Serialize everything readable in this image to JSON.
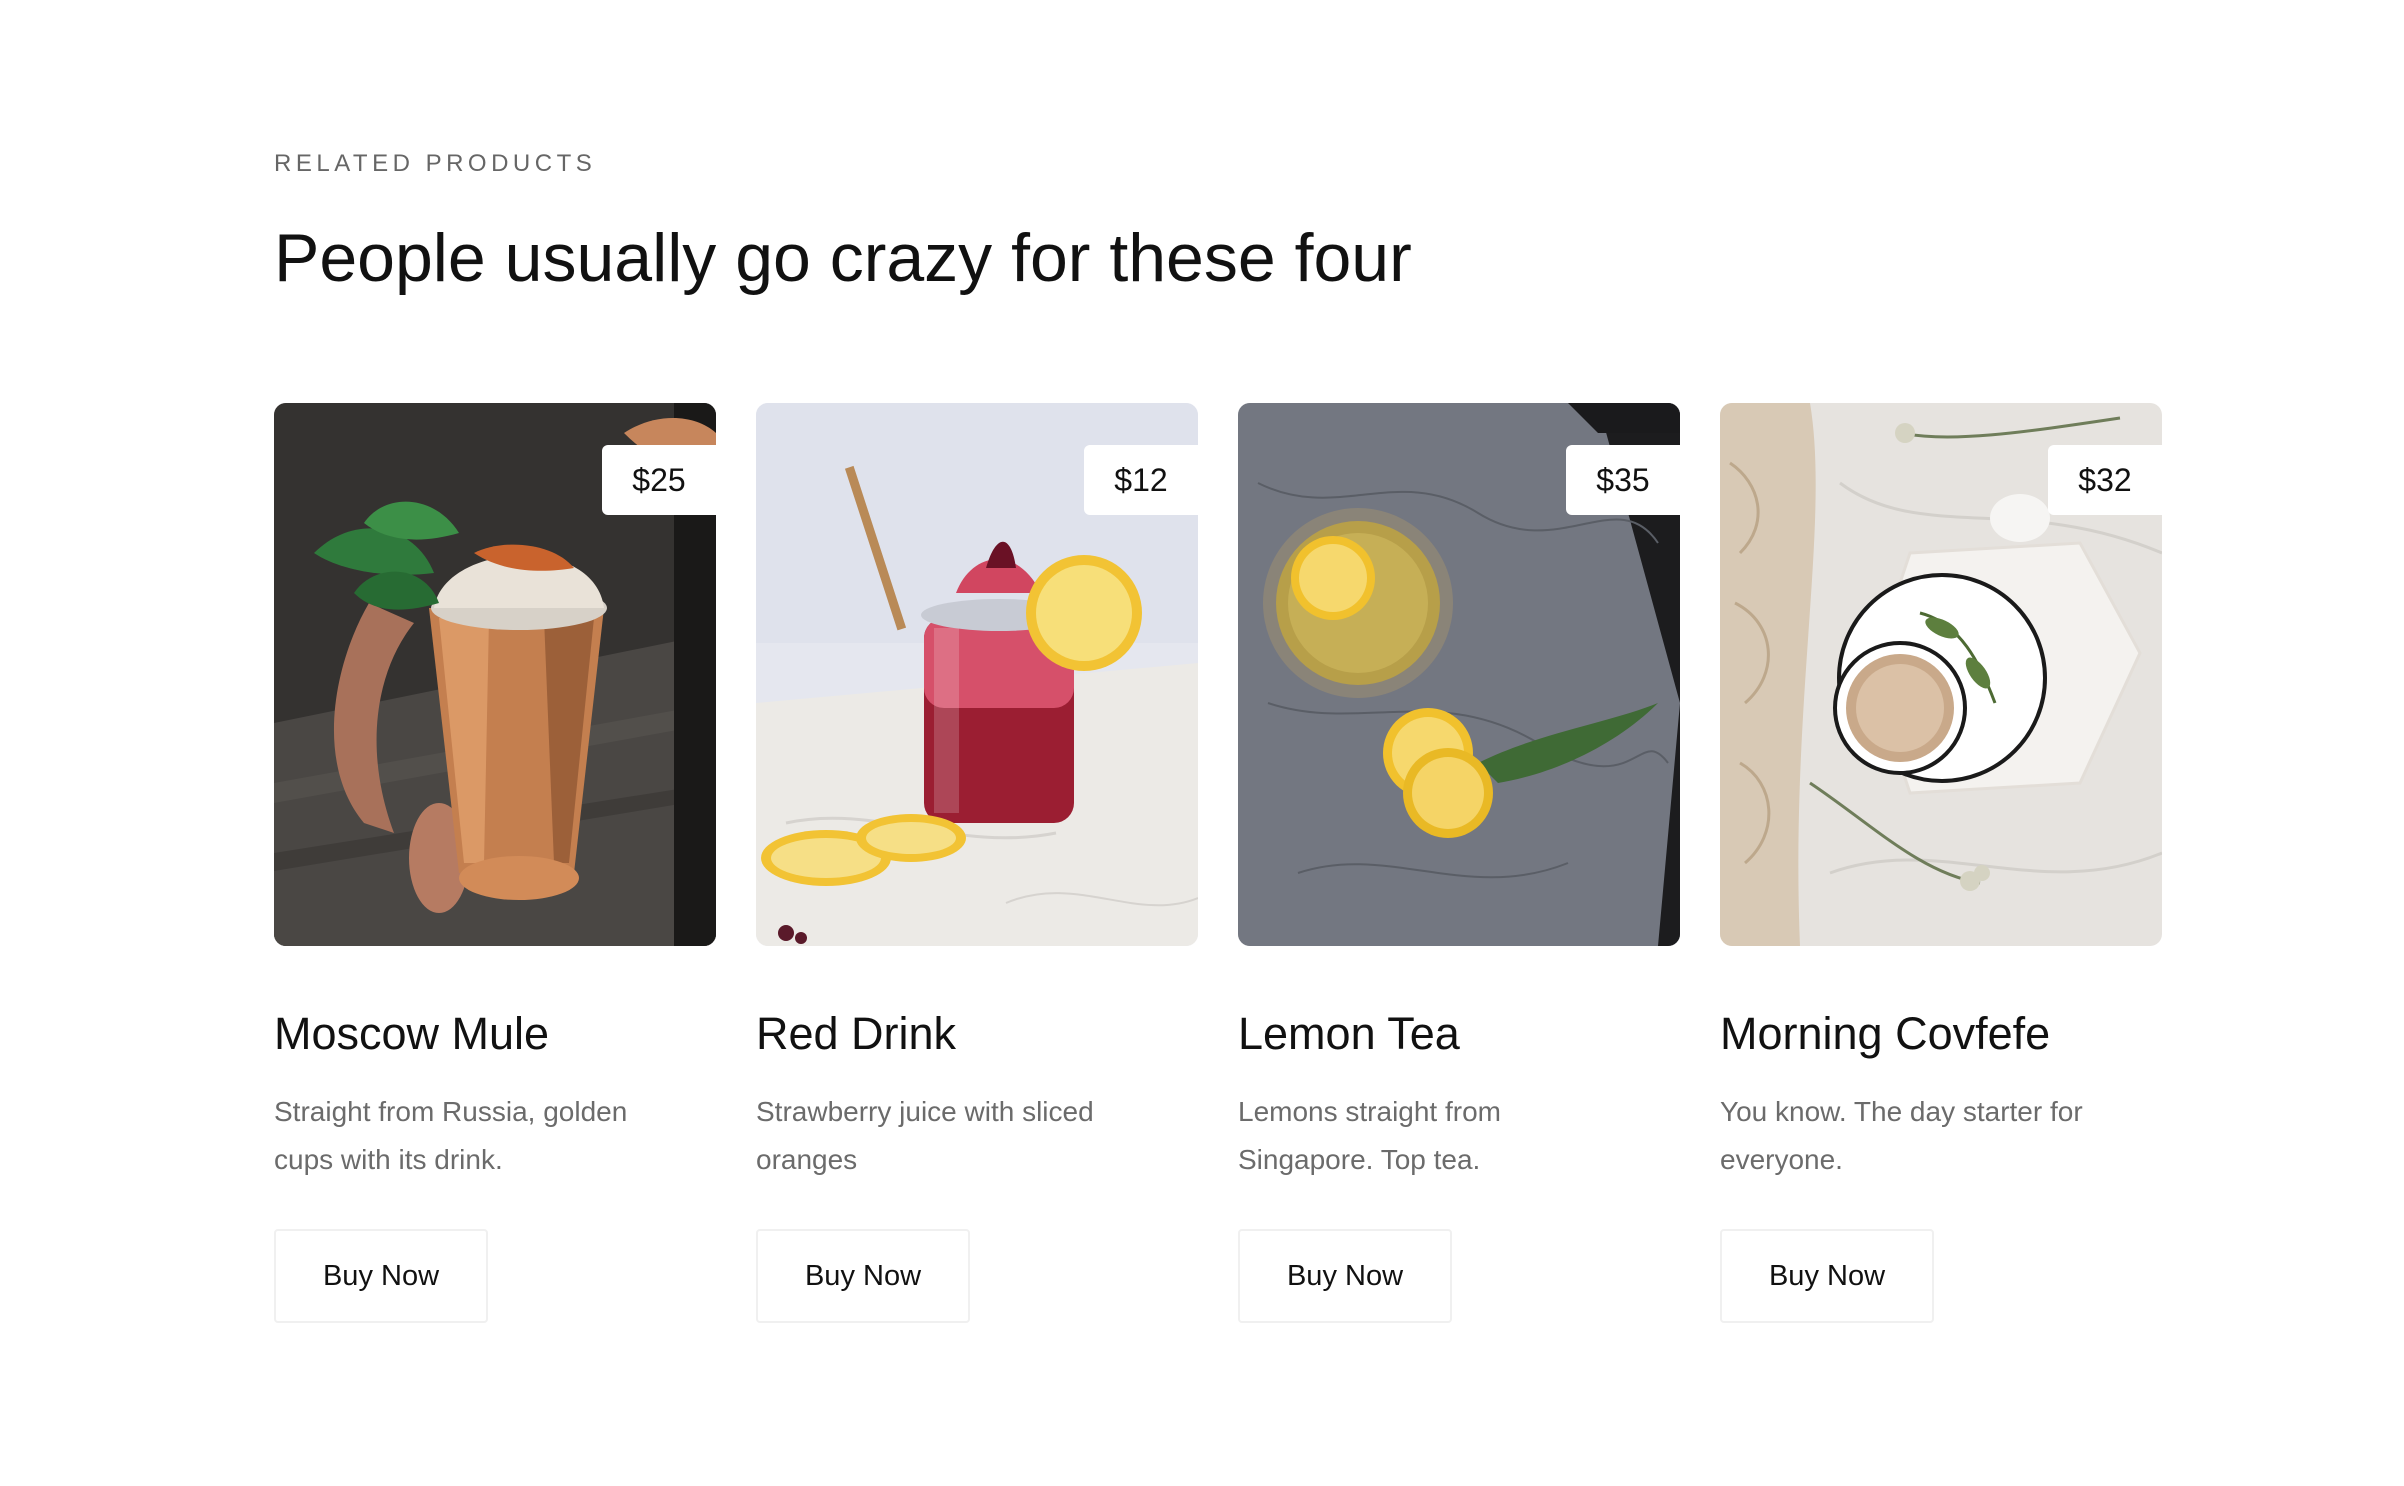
{
  "section": {
    "eyebrow": "RELATED PRODUCTS",
    "headline": "People usually go crazy for these four"
  },
  "products": [
    {
      "name": "Moscow Mule",
      "price": "$25",
      "description": "Straight from Russia, golden cups with its drink.",
      "button": "Buy Now",
      "image": "copper-mug-cocktail-photo"
    },
    {
      "name": "Red Drink",
      "price": "$12",
      "description": "Strawberry juice with sliced oranges",
      "button": "Buy Now",
      "image": "red-drink-jar-photo"
    },
    {
      "name": "Lemon Tea",
      "price": "$35",
      "description": "Lemons straight from Singapore. Top tea.",
      "button": "Buy Now",
      "image": "lemon-tea-cup-photo"
    },
    {
      "name": "Morning Covfefe",
      "price": "$32",
      "description": "You know. The day starter for everyone.",
      "button": "Buy Now",
      "image": "coffee-cup-bed-photo"
    }
  ],
  "colors": {
    "text_primary": "#111111",
    "text_muted": "#6b6b6b",
    "button_border": "#f0f0f0",
    "background": "#ffffff"
  }
}
